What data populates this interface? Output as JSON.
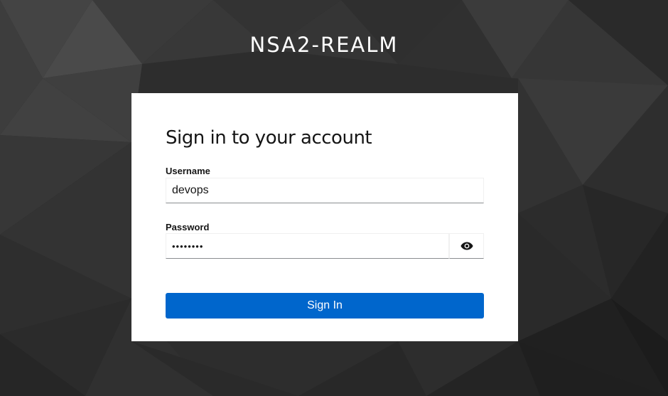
{
  "realm": {
    "title": "NSA2-REALM"
  },
  "login": {
    "heading": "Sign in to your account",
    "username_label": "Username",
    "username_value": "devops",
    "password_label": "Password",
    "password_value": "••••••••",
    "reveal_icon": "eye-icon",
    "submit_label": "Sign In"
  },
  "colors": {
    "background": "#2b2b2b",
    "card": "#ffffff",
    "primary_button": "#0066cc",
    "text": "#151515"
  }
}
